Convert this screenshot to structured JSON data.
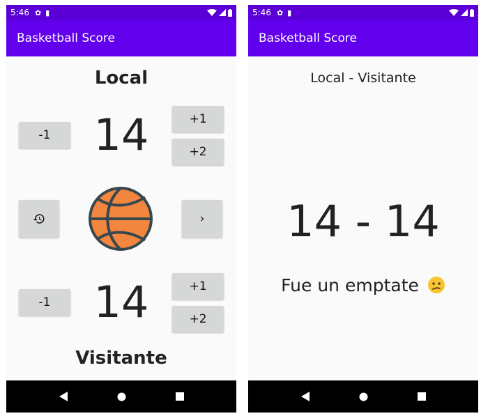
{
  "status_bar": {
    "time": "5:46"
  },
  "app": {
    "title": "Basketball Score"
  },
  "left": {
    "local_title": "Local",
    "local_score": "14",
    "visitor_title": "Visitante",
    "visitor_score": "14",
    "minus_label": "-1",
    "plus1_label": "+1",
    "plus2_label": "+2",
    "next_label": "›"
  },
  "right": {
    "matchup": "Local - Visitante",
    "final_score": "14 - 14",
    "result": "Fue un emptate"
  },
  "colors": {
    "status_bar": "#5a00d6",
    "app_bar": "#6200ee",
    "button": "#d6d7d7",
    "ball": "#f2863f",
    "ball_lines": "#37474f"
  }
}
